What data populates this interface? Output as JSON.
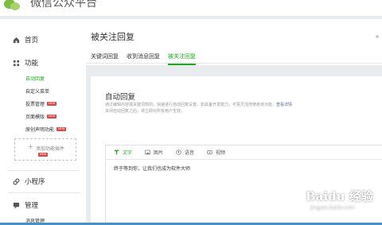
{
  "app": {
    "title": "微信公众平台",
    "accent": "#1aad19"
  },
  "sidebar": {
    "home": {
      "label": "首页",
      "icon": "home-icon"
    },
    "features": {
      "label": "功能",
      "icon": "grid-icon",
      "items": [
        {
          "label": "自动回复",
          "active": true,
          "new": false
        },
        {
          "label": "自定义菜单",
          "active": false,
          "new": false
        },
        {
          "label": "投票管理",
          "active": false,
          "new": true
        },
        {
          "label": "页面模版",
          "active": false,
          "new": true
        },
        {
          "label": "原创声明功能",
          "active": false,
          "new": true
        }
      ],
      "add_plugin": {
        "label": "添加功能插件",
        "new": true
      }
    },
    "miniprogram": {
      "label": "小程序",
      "icon": "link-icon"
    },
    "manage": {
      "label": "管理",
      "icon": "chat-icon",
      "items": [
        {
          "label": "消息管理"
        }
      ]
    },
    "new_tag": "NEW"
  },
  "main": {
    "title": "被关注回复",
    "tabs": [
      {
        "label": "关键词回复",
        "active": false
      },
      {
        "label": "收到消息回复",
        "active": false
      },
      {
        "label": "被关注回复",
        "active": true
      }
    ]
  },
  "card": {
    "title": "自动回复",
    "desc_line1": "通过编辑内容或关键词规则，快速进行自动回复设置。如具备开发能力，可更灵活地使用该功能。",
    "desc_link": "查看详情",
    "desc_line2": "关闭自动回复之后，将立即对所有用户生效。"
  },
  "editor": {
    "tools": [
      {
        "label": "文字",
        "icon": "text-icon",
        "active": true
      },
      {
        "label": "图片",
        "icon": "image-icon",
        "active": false
      },
      {
        "label": "语音",
        "icon": "voice-icon",
        "active": false
      },
      {
        "label": "视频",
        "icon": "video-icon",
        "active": false
      }
    ],
    "content": "终于等到你，让我们也成为软件大师"
  },
  "watermark": {
    "main": "Baidu 经验",
    "sub": "jingyan.baidu.com"
  }
}
